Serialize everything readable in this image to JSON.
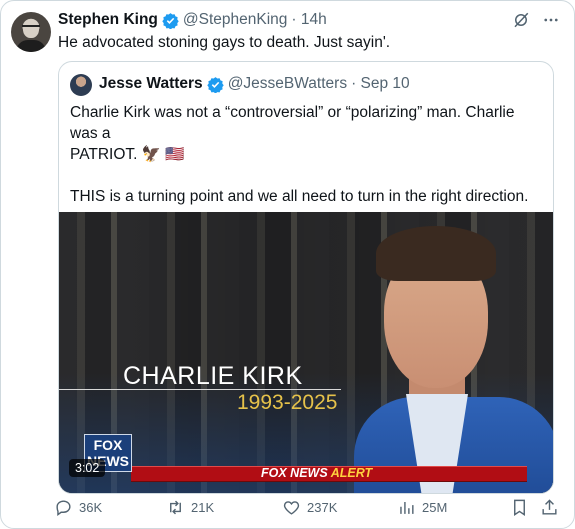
{
  "tweet": {
    "author": {
      "name": "Stephen King",
      "handle": "@StephenKing",
      "time": "· 14h"
    },
    "text": "He advocated stoning gays to death. Just sayin'."
  },
  "quote": {
    "author": {
      "name": "Jesse Watters",
      "handle": "@JesseBWatters",
      "date": "· Sep 10"
    },
    "line1": "Charlie Kirk was not a “controversial” or “polarizing” man. Charlie was a",
    "line2": "PATRIOT. 🦅 🇺🇸",
    "line3": "THIS is a turning point and we all need to turn in the right direction.",
    "line4": "...",
    "media": {
      "lower_third_name": "CHARLIE KIRK",
      "lower_third_years": "1993-2025",
      "logo_line1": "FOX",
      "logo_line2": "NEWS",
      "alert_prefix": "FOX NEWS ",
      "alert_word": "ALERT",
      "duration": "3:02"
    }
  },
  "actions": {
    "replies": "36K",
    "reposts": "21K",
    "likes": "237K",
    "views": "25M"
  },
  "colors": {
    "verified": "#1d9bf0",
    "muted": "#536471",
    "alert_red": "#b10d14",
    "alert_yellow": "#ffd23f"
  }
}
